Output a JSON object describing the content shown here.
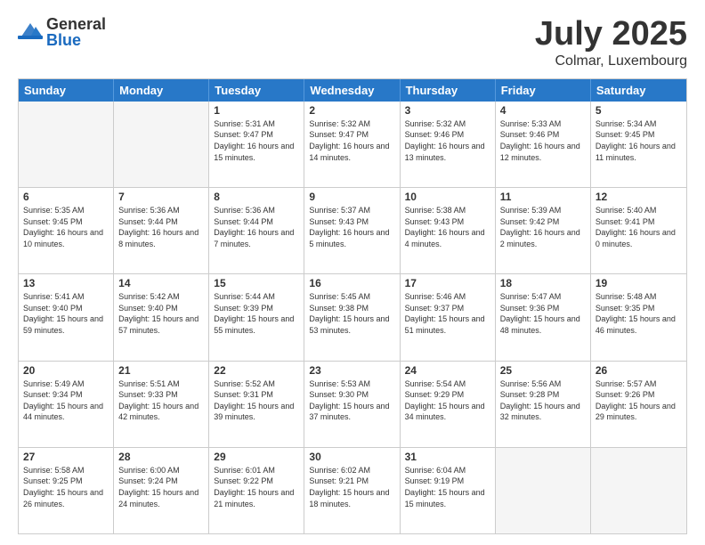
{
  "logo": {
    "general": "General",
    "blue": "Blue"
  },
  "title": "July 2025",
  "location": "Colmar, Luxembourg",
  "days_of_week": [
    "Sunday",
    "Monday",
    "Tuesday",
    "Wednesday",
    "Thursday",
    "Friday",
    "Saturday"
  ],
  "weeks": [
    [
      {
        "day": "",
        "info": ""
      },
      {
        "day": "",
        "info": ""
      },
      {
        "day": "1",
        "info": "Sunrise: 5:31 AM\nSunset: 9:47 PM\nDaylight: 16 hours and 15 minutes."
      },
      {
        "day": "2",
        "info": "Sunrise: 5:32 AM\nSunset: 9:47 PM\nDaylight: 16 hours and 14 minutes."
      },
      {
        "day": "3",
        "info": "Sunrise: 5:32 AM\nSunset: 9:46 PM\nDaylight: 16 hours and 13 minutes."
      },
      {
        "day": "4",
        "info": "Sunrise: 5:33 AM\nSunset: 9:46 PM\nDaylight: 16 hours and 12 minutes."
      },
      {
        "day": "5",
        "info": "Sunrise: 5:34 AM\nSunset: 9:45 PM\nDaylight: 16 hours and 11 minutes."
      }
    ],
    [
      {
        "day": "6",
        "info": "Sunrise: 5:35 AM\nSunset: 9:45 PM\nDaylight: 16 hours and 10 minutes."
      },
      {
        "day": "7",
        "info": "Sunrise: 5:36 AM\nSunset: 9:44 PM\nDaylight: 16 hours and 8 minutes."
      },
      {
        "day": "8",
        "info": "Sunrise: 5:36 AM\nSunset: 9:44 PM\nDaylight: 16 hours and 7 minutes."
      },
      {
        "day": "9",
        "info": "Sunrise: 5:37 AM\nSunset: 9:43 PM\nDaylight: 16 hours and 5 minutes."
      },
      {
        "day": "10",
        "info": "Sunrise: 5:38 AM\nSunset: 9:43 PM\nDaylight: 16 hours and 4 minutes."
      },
      {
        "day": "11",
        "info": "Sunrise: 5:39 AM\nSunset: 9:42 PM\nDaylight: 16 hours and 2 minutes."
      },
      {
        "day": "12",
        "info": "Sunrise: 5:40 AM\nSunset: 9:41 PM\nDaylight: 16 hours and 0 minutes."
      }
    ],
    [
      {
        "day": "13",
        "info": "Sunrise: 5:41 AM\nSunset: 9:40 PM\nDaylight: 15 hours and 59 minutes."
      },
      {
        "day": "14",
        "info": "Sunrise: 5:42 AM\nSunset: 9:40 PM\nDaylight: 15 hours and 57 minutes."
      },
      {
        "day": "15",
        "info": "Sunrise: 5:44 AM\nSunset: 9:39 PM\nDaylight: 15 hours and 55 minutes."
      },
      {
        "day": "16",
        "info": "Sunrise: 5:45 AM\nSunset: 9:38 PM\nDaylight: 15 hours and 53 minutes."
      },
      {
        "day": "17",
        "info": "Sunrise: 5:46 AM\nSunset: 9:37 PM\nDaylight: 15 hours and 51 minutes."
      },
      {
        "day": "18",
        "info": "Sunrise: 5:47 AM\nSunset: 9:36 PM\nDaylight: 15 hours and 48 minutes."
      },
      {
        "day": "19",
        "info": "Sunrise: 5:48 AM\nSunset: 9:35 PM\nDaylight: 15 hours and 46 minutes."
      }
    ],
    [
      {
        "day": "20",
        "info": "Sunrise: 5:49 AM\nSunset: 9:34 PM\nDaylight: 15 hours and 44 minutes."
      },
      {
        "day": "21",
        "info": "Sunrise: 5:51 AM\nSunset: 9:33 PM\nDaylight: 15 hours and 42 minutes."
      },
      {
        "day": "22",
        "info": "Sunrise: 5:52 AM\nSunset: 9:31 PM\nDaylight: 15 hours and 39 minutes."
      },
      {
        "day": "23",
        "info": "Sunrise: 5:53 AM\nSunset: 9:30 PM\nDaylight: 15 hours and 37 minutes."
      },
      {
        "day": "24",
        "info": "Sunrise: 5:54 AM\nSunset: 9:29 PM\nDaylight: 15 hours and 34 minutes."
      },
      {
        "day": "25",
        "info": "Sunrise: 5:56 AM\nSunset: 9:28 PM\nDaylight: 15 hours and 32 minutes."
      },
      {
        "day": "26",
        "info": "Sunrise: 5:57 AM\nSunset: 9:26 PM\nDaylight: 15 hours and 29 minutes."
      }
    ],
    [
      {
        "day": "27",
        "info": "Sunrise: 5:58 AM\nSunset: 9:25 PM\nDaylight: 15 hours and 26 minutes."
      },
      {
        "day": "28",
        "info": "Sunrise: 6:00 AM\nSunset: 9:24 PM\nDaylight: 15 hours and 24 minutes."
      },
      {
        "day": "29",
        "info": "Sunrise: 6:01 AM\nSunset: 9:22 PM\nDaylight: 15 hours and 21 minutes."
      },
      {
        "day": "30",
        "info": "Sunrise: 6:02 AM\nSunset: 9:21 PM\nDaylight: 15 hours and 18 minutes."
      },
      {
        "day": "31",
        "info": "Sunrise: 6:04 AM\nSunset: 9:19 PM\nDaylight: 15 hours and 15 minutes."
      },
      {
        "day": "",
        "info": ""
      },
      {
        "day": "",
        "info": ""
      }
    ]
  ]
}
